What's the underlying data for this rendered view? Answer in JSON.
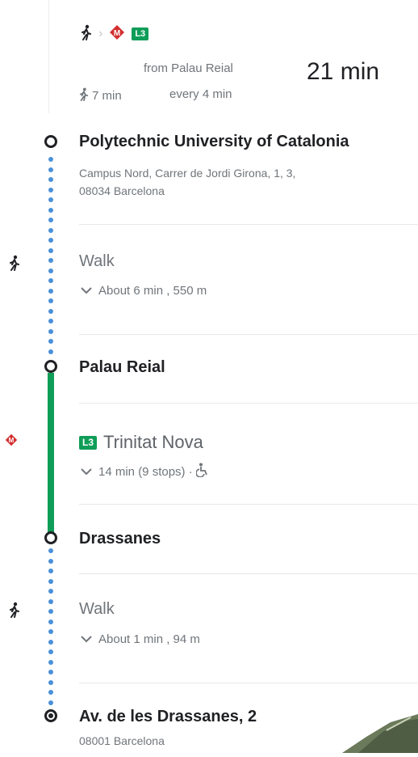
{
  "header": {
    "line_badge": "L3",
    "from_text": "from Palau Reial",
    "duration": "21 min",
    "walk_time": "7 min",
    "frequency": "every 4 min"
  },
  "start": {
    "name": "Polytechnic University of Catalonia",
    "address_line1": "Campus Nord, Carrer de Jordi Girona, 1, 3,",
    "address_line2": "08034 Barcelona"
  },
  "walk1": {
    "title": "Walk",
    "detail": "About 6 min , 550 m"
  },
  "stop_palau": {
    "name": "Palau Reial"
  },
  "transit": {
    "line_badge": "L3",
    "destination": "Trinitat Nova",
    "detail": "14 min (9 stops) ·"
  },
  "stop_drassanes": {
    "name": "Drassanes"
  },
  "walk2": {
    "title": "Walk",
    "detail": "About 1 min , 94 m"
  },
  "end": {
    "name": "Av. de les Drassanes, 2",
    "address": "08001 Barcelona"
  },
  "colors": {
    "metro_green": "#0f9d58",
    "walk_dots": "#4a90d9",
    "metro_red": "#d32f2f"
  },
  "icons": [
    "walk-icon",
    "metro-icon",
    "chevron-right-icon",
    "chevron-down-icon",
    "wheelchair-icon"
  ]
}
